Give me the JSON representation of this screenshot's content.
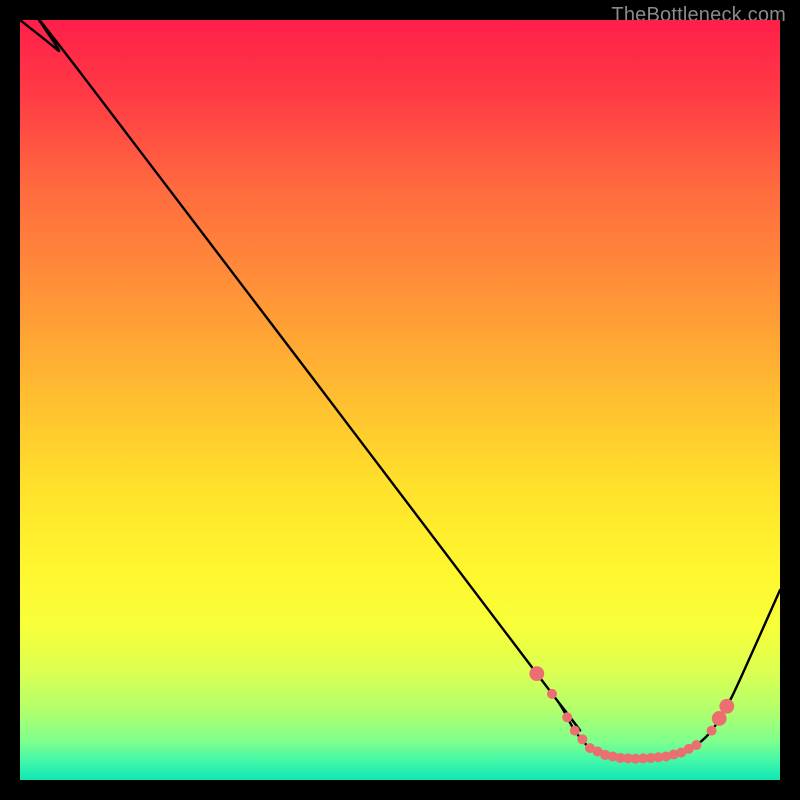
{
  "watermark": "TheBottleneck.com",
  "chart_data": {
    "type": "line",
    "xlim": [
      0,
      100
    ],
    "ylim": [
      0,
      100
    ],
    "curve": [
      {
        "x": 0,
        "y": 100
      },
      {
        "x": 5,
        "y": 96
      },
      {
        "x": 8,
        "y": 93
      },
      {
        "x": 68,
        "y": 14
      },
      {
        "x": 71,
        "y": 10
      },
      {
        "x": 73,
        "y": 6.5
      },
      {
        "x": 75,
        "y": 4.2
      },
      {
        "x": 77,
        "y": 3.3
      },
      {
        "x": 79,
        "y": 2.9
      },
      {
        "x": 81,
        "y": 2.8
      },
      {
        "x": 83,
        "y": 2.9
      },
      {
        "x": 85,
        "y": 3.1
      },
      {
        "x": 87,
        "y": 3.6
      },
      {
        "x": 89,
        "y": 4.6
      },
      {
        "x": 91,
        "y": 6.5
      },
      {
        "x": 93,
        "y": 9.7
      },
      {
        "x": 95,
        "y": 13.8
      },
      {
        "x": 100,
        "y": 25
      }
    ],
    "markers_x": [
      68,
      70,
      72,
      73,
      74,
      75,
      76,
      77,
      78,
      79,
      80,
      81,
      82,
      83,
      84,
      85,
      86,
      87,
      88,
      89,
      91,
      92,
      93
    ],
    "marker_color": "#eb6f70",
    "marker_radius_default": 5.0,
    "marker_radius_large": 7.4,
    "marker_large_x_set": [
      68,
      92,
      93
    ],
    "gradient_stops": [
      {
        "offset": 0.0,
        "color": "#ff1f4a"
      },
      {
        "offset": 0.1,
        "color": "#ff3b45"
      },
      {
        "offset": 0.22,
        "color": "#ff6a3f"
      },
      {
        "offset": 0.36,
        "color": "#ff9338"
      },
      {
        "offset": 0.5,
        "color": "#ffbf30"
      },
      {
        "offset": 0.62,
        "color": "#ffe32b"
      },
      {
        "offset": 0.72,
        "color": "#fff62f"
      },
      {
        "offset": 0.8,
        "color": "#f7ff3a"
      },
      {
        "offset": 0.86,
        "color": "#d9ff53"
      },
      {
        "offset": 0.91,
        "color": "#b0ff6e"
      },
      {
        "offset": 0.95,
        "color": "#7dff8e"
      },
      {
        "offset": 0.975,
        "color": "#42f7a8"
      },
      {
        "offset": 1.0,
        "color": "#11e7b6"
      }
    ]
  }
}
